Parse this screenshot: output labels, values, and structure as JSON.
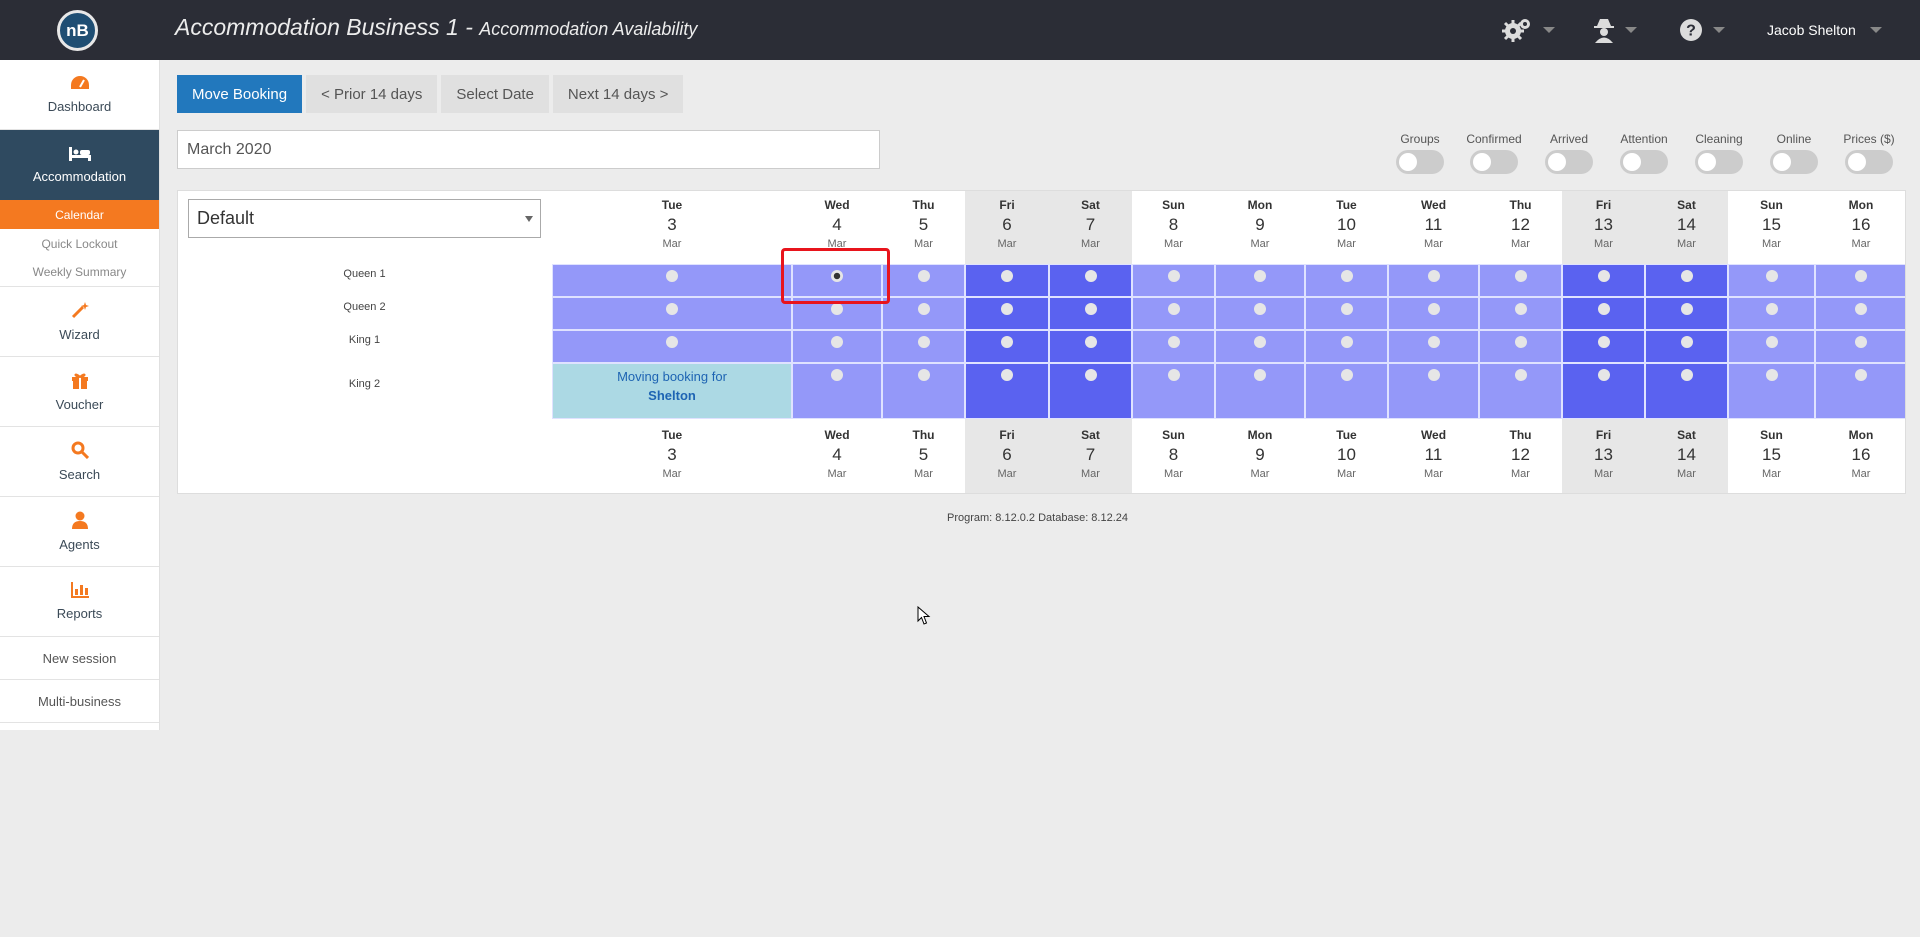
{
  "header": {
    "logo_text": "nB",
    "title": "Accommodation Business 1 - ",
    "subtitle": "Accommodation Availability",
    "user": "Jacob Shelton",
    "icons": [
      "gears-icon",
      "spy-icon",
      "help-icon"
    ]
  },
  "sidebar": {
    "items": [
      {
        "label": "Dashboard",
        "icon": "dashboard-icon"
      },
      {
        "label": "Accommodation",
        "icon": "bed-icon"
      },
      {
        "label": "Calendar"
      },
      {
        "label": "Quick Lockout"
      },
      {
        "label": "Weekly Summary"
      },
      {
        "label": "Wizard",
        "icon": "wand-icon"
      },
      {
        "label": "Voucher",
        "icon": "gift-icon"
      },
      {
        "label": "Search",
        "icon": "search-icon"
      },
      {
        "label": "Agents",
        "icon": "user-icon"
      },
      {
        "label": "Reports",
        "icon": "bar-chart-icon"
      },
      {
        "label": "New session"
      },
      {
        "label": "Multi-business"
      }
    ]
  },
  "toolbar": {
    "move_booking": "Move Booking",
    "prior": "< Prior 14 days",
    "select_date": "Select Date",
    "next": "Next 14 days >"
  },
  "month_value": "March 2020",
  "toggles": [
    "Groups",
    "Confirmed",
    "Arrived",
    "Attention",
    "Cleaning",
    "Online",
    "Prices ($)"
  ],
  "room_type_select": "Default",
  "days": [
    {
      "dow": "Tue",
      "num": "3",
      "mon": "Mar"
    },
    {
      "dow": "Wed",
      "num": "4",
      "mon": "Mar"
    },
    {
      "dow": "Thu",
      "num": "5",
      "mon": "Mar"
    },
    {
      "dow": "Fri",
      "num": "6",
      "mon": "Mar"
    },
    {
      "dow": "Sat",
      "num": "7",
      "mon": "Mar"
    },
    {
      "dow": "Sun",
      "num": "8",
      "mon": "Mar"
    },
    {
      "dow": "Mon",
      "num": "9",
      "mon": "Mar"
    },
    {
      "dow": "Tue",
      "num": "10",
      "mon": "Mar"
    },
    {
      "dow": "Wed",
      "num": "11",
      "mon": "Mar"
    },
    {
      "dow": "Thu",
      "num": "12",
      "mon": "Mar"
    },
    {
      "dow": "Fri",
      "num": "13",
      "mon": "Mar"
    },
    {
      "dow": "Sat",
      "num": "14",
      "mon": "Mar"
    },
    {
      "dow": "Sun",
      "num": "15",
      "mon": "Mar"
    },
    {
      "dow": "Mon",
      "num": "16",
      "mon": "Mar"
    }
  ],
  "rooms": [
    "Queen 1",
    "Queen 2",
    "King 1",
    "King 2"
  ],
  "moving_booking": {
    "text": "Moving booking for",
    "name": "Shelton"
  },
  "selected_slot": {
    "room": "Queen 1",
    "day": "4"
  },
  "colors": {
    "weekday_cell": "#9498f9",
    "weekend_cell": "#5a62f0",
    "accent": "#f47920",
    "primary_button": "#2278bd",
    "sidebar_active": "#2f4a60",
    "moving_booking": "#acd9e4",
    "highlight": "#e8141c"
  },
  "version": "Program: 8.12.0.2 Database: 8.12.24"
}
